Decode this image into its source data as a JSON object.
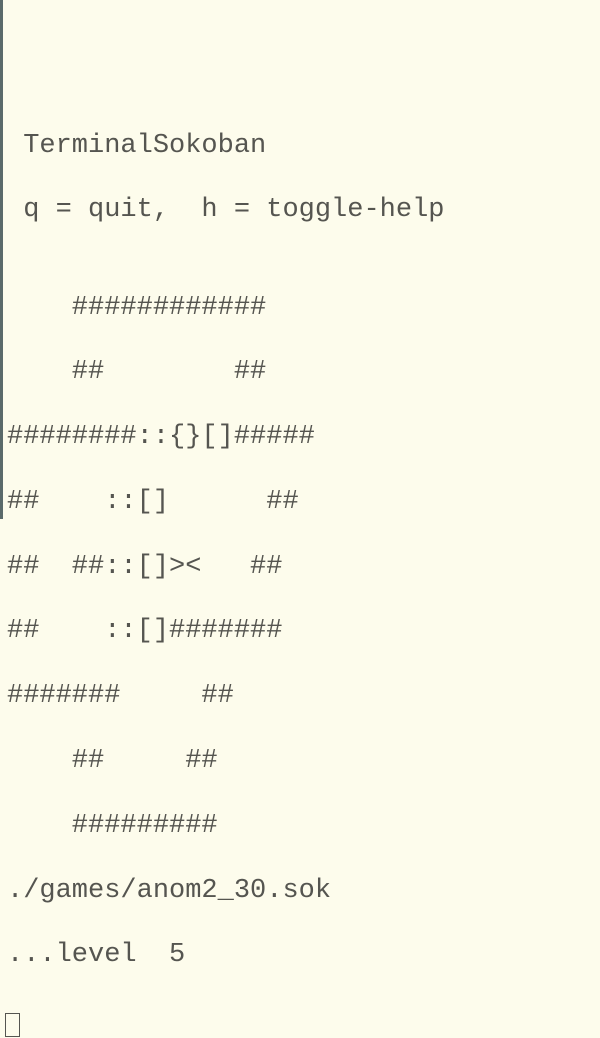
{
  "header": {
    "title": " TerminalSokoban",
    "help_hint": " q = quit,  h = toggle-help"
  },
  "board": {
    "rows": [
      "",
      "    ############",
      "    ##        ##",
      "########::{}[]#####",
      "##    ::[]      ##",
      "##  ##::[]><   ##",
      "##    ::[]#######",
      "#######     ##",
      "    ##     ##",
      "    #########"
    ]
  },
  "footer": {
    "file_path": "./games/anom2_30.sok",
    "level_label": "...level  5"
  },
  "game": {
    "legend": {
      "wall": "##",
      "goal": "::",
      "box_on_goal": "{}",
      "box": "[]",
      "player": "><"
    },
    "source_file": "./games/anom2_30.sok",
    "level_number": 5
  }
}
